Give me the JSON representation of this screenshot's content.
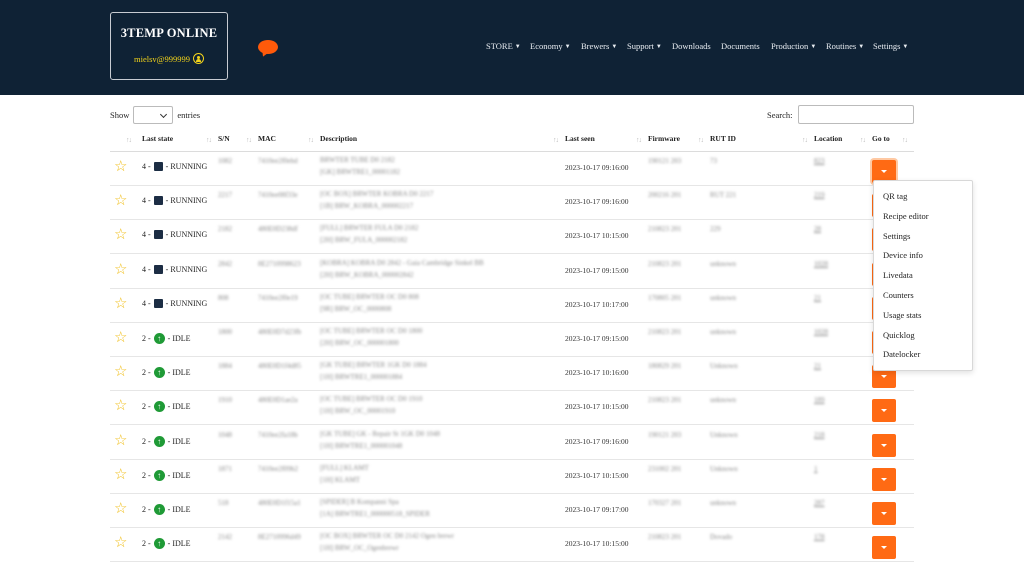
{
  "brand": {
    "title": "3TEMP ONLINE",
    "user": "mielsv@999999"
  },
  "nav": [
    {
      "label": "STORE",
      "caret": true
    },
    {
      "label": "Economy",
      "caret": true
    },
    {
      "label": "Brewers",
      "caret": true
    },
    {
      "label": "Support",
      "caret": true
    },
    {
      "label": "Downloads",
      "caret": false
    },
    {
      "label": "Documents",
      "caret": false
    },
    {
      "label": "Production",
      "caret": true
    },
    {
      "label": "Routines",
      "caret": true
    },
    {
      "label": "Settings",
      "caret": true
    }
  ],
  "controls": {
    "show_label": "Show",
    "entries_label": "entries",
    "search_label": "Search:"
  },
  "columns": [
    "Last state",
    "S/N",
    "MAC",
    "Description",
    "Last seen",
    "Firmware",
    "RUT ID",
    "Location",
    "Go to"
  ],
  "rows": [
    {
      "state": "4 -",
      "status": "RUNNING",
      "icon": "square",
      "sn": "1082",
      "mac": "7410ee2f0ebd",
      "desc1": "BRWTER TUBE D0 2182",
      "desc2": "[GK] BRWTRE1_00001182",
      "seen": "2023-10-17 09:16:00",
      "fw": "190121 203",
      "rut": "73",
      "loc": "823"
    },
    {
      "state": "4 -",
      "status": "RUNNING",
      "icon": "square",
      "sn": "2217",
      "mac": "7410ee08f33e",
      "desc1": "[OC BOX] BRWTER KOBRA D0 2217",
      "desc2": "[1B] BRW_KOBRA_000002217",
      "seen": "2023-10-17 09:16:00",
      "fw": "200216 201",
      "rut": "RUT 221",
      "loc": "219"
    },
    {
      "state": "4 -",
      "status": "RUNNING",
      "icon": "square",
      "sn": "2182",
      "mac": "480E0D238df",
      "desc1": "[FULL] BRWTER FULA D0 2182",
      "desc2": "[2H] BRW_FULA_000002182",
      "seen": "2023-10-17 10:15:00",
      "fw": "210823 201",
      "rut": "229",
      "loc": "28"
    },
    {
      "state": "4 -",
      "status": "RUNNING",
      "icon": "square",
      "sn": "2842",
      "mac": "8E2710998623",
      "desc1": "[KOBRA] KOBRA D0 2842 - Gaia Cambridge Sinkel BB",
      "desc2": "[2H] BRW_KOBRA_000002842",
      "seen": "2023-10-17 09:15:00",
      "fw": "210823 201",
      "rut": "unknown",
      "loc": "1028"
    },
    {
      "state": "4 -",
      "status": "RUNNING",
      "icon": "square",
      "sn": "808",
      "mac": "7410ee2f0e19",
      "desc1": "[OC TUBE] BRWTER OC D0 808",
      "desc2": "[9R] BRW_OC_0000808",
      "seen": "2023-10-17 10:17:00",
      "fw": "170805 201",
      "rut": "unknown",
      "loc": "21"
    },
    {
      "state": "2 -",
      "status": "IDLE",
      "icon": "up",
      "sn": "1800",
      "mac": "480E0D7d23fb",
      "desc1": "[OC TUBE] BRWTER OC D0 1800",
      "desc2": "[2H] BRW_OC_000001800",
      "seen": "2023-10-17 09:15:00",
      "fw": "210823 201",
      "rut": "unknown",
      "loc": "1028"
    },
    {
      "state": "2 -",
      "status": "IDLE",
      "icon": "up",
      "sn": "1884",
      "mac": "480E0D1f4d85",
      "desc1": "[GK TUBE] BRWTER 1GK D0 1884",
      "desc2": "[1H] BRWTRE1_000001884",
      "seen": "2023-10-17 10:16:00",
      "fw": "180829 201",
      "rut": "Unknown",
      "loc": "21"
    },
    {
      "state": "2 -",
      "status": "IDLE",
      "icon": "up",
      "sn": "1910",
      "mac": "480E0D1ae2a",
      "desc1": "[OC TUBE] BRWTER OC D0 1910",
      "desc2": "[1H] BRW_OC_00001910",
      "seen": "2023-10-17 10:15:00",
      "fw": "210823 201",
      "rut": "unknown",
      "loc": "189"
    },
    {
      "state": "2 -",
      "status": "IDLE",
      "icon": "up",
      "sn": "1048",
      "mac": "7410ee2fa18b",
      "desc1": "[GK TUBE] GK - Repair St 1GK D0 1048",
      "desc2": "[1H] BRWTRE1_000001048",
      "seen": "2023-10-17 09:16:00",
      "fw": "190121 203",
      "rut": "Unknown",
      "loc": "218"
    },
    {
      "state": "2 -",
      "status": "IDLE",
      "icon": "up",
      "sn": "1871",
      "mac": "7410ee2f09b2",
      "desc1": "[FULL] KLAMT",
      "desc2": "[1H] KLAMT",
      "seen": "2023-10-17 10:15:00",
      "fw": "231002 201",
      "rut": "Unknown",
      "loc": "1"
    },
    {
      "state": "2 -",
      "status": "IDLE",
      "icon": "up",
      "sn": "518",
      "mac": "480E0D1f15a1",
      "desc1": "[SPIDER] B Kompanni Spa",
      "desc2": "[1A] BRWTRE1_000000518_SPIDER",
      "seen": "2023-10-17 09:17:00",
      "fw": "170327 201",
      "rut": "unknown",
      "loc": "287"
    },
    {
      "state": "2 -",
      "status": "IDLE",
      "icon": "up",
      "sn": "2142",
      "mac": "8E2710996d49",
      "desc1": "[OC BOX] BRWTER OC D0 2142 Ogen brewr",
      "desc2": "[1H] BRW_OC_Ogenbrewr",
      "seen": "2023-10-17 10:15:00",
      "fw": "210823 201",
      "rut": "Dovado",
      "loc": "178"
    }
  ],
  "goto_menu": [
    "QR tag",
    "Recipe editor",
    "Settings",
    "Device info",
    "Livedata",
    "Counters",
    "Usage stats",
    "Quicklog",
    "Datelocker"
  ]
}
